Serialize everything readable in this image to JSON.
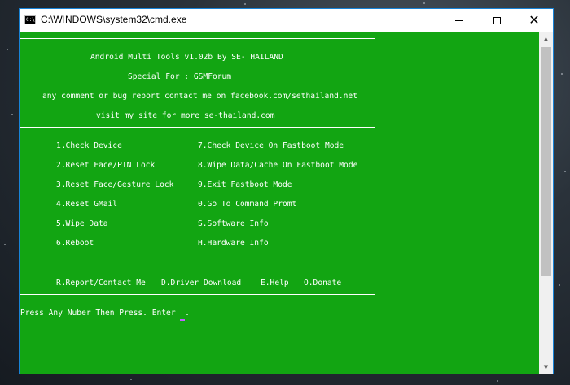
{
  "window": {
    "title": "C:\\WINDOWS\\system32\\cmd.exe",
    "background_color": "#12a512",
    "text_color": "#ffffff",
    "close_glyph": "✕"
  },
  "console": {
    "header": [
      "Android Multi Tools v1.02b By SE-THAILAND",
      "Special For : GSMForum",
      "any comment or bug report contact me on facebook.com/sethailand.net",
      "visit my site for more se-thailand.com"
    ],
    "menu_left": [
      "1.Check Device",
      "2.Reset Face/PIN Lock",
      "3.Reset Face/Gesture Lock",
      "4.Reset GMail",
      "5.Wipe Data",
      "6.Reboot"
    ],
    "menu_right": [
      "7.Check Device On Fastboot Mode",
      "8.Wipe Data/Cache On Fastboot Mode",
      "9.Exit Fastboot Mode",
      "0.Go To Command Promt",
      "S.Software Info",
      "H.Hardware Info"
    ],
    "bottom_options": [
      "R.Report/Contact Me",
      "D.Driver Download",
      "E.Help",
      "O.Donate"
    ],
    "prompt": "Press Any Nuber Then Press. Enter  ."
  },
  "scrollbar": {
    "up_glyph": "▲",
    "down_glyph": "▼"
  }
}
